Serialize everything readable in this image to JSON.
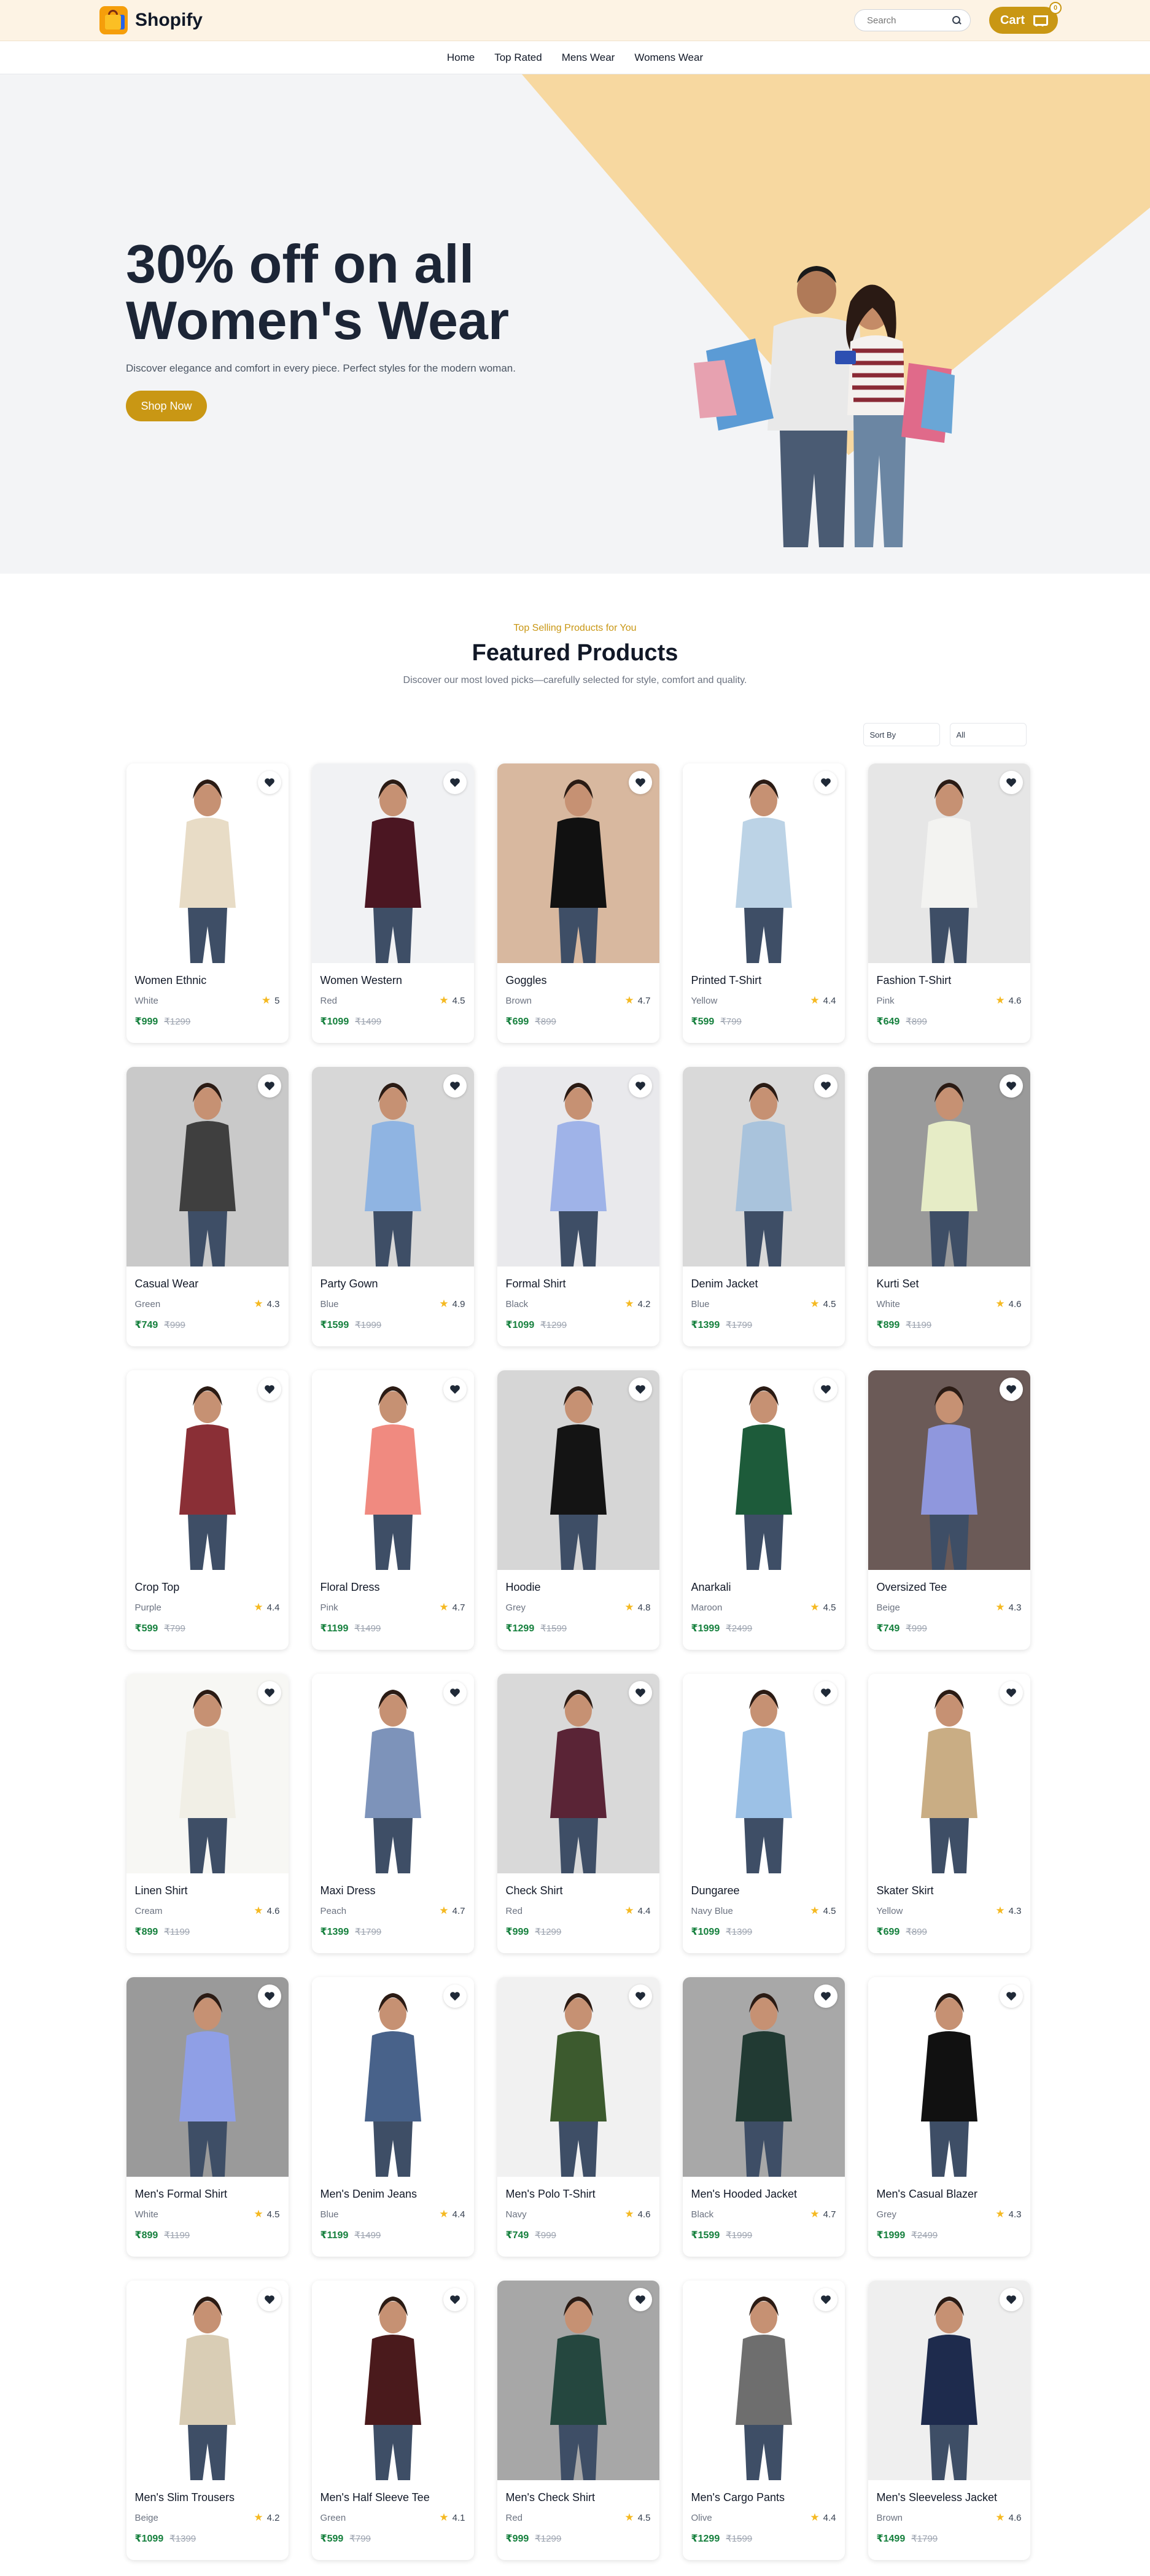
{
  "header": {
    "brand": "Shopify",
    "search_placeholder": "Search",
    "cart_label": "Cart",
    "cart_count": "0"
  },
  "nav": [
    "Home",
    "Top Rated",
    "Mens Wear",
    "Womens Wear"
  ],
  "hero": {
    "title_line1": "30% off on all",
    "title_line2": "Women's Wear",
    "subtitle": "Discover elegance and comfort in every piece. Perfect styles for the modern woman.",
    "cta": "Shop Now",
    "accent_color": "#f7d8a0"
  },
  "featured": {
    "kicker": "Top Selling Products for You",
    "title": "Featured Products",
    "description": "Discover our most loved picks—carefully selected for style, comfort and quality.",
    "sort_label": "Sort By",
    "filter_value": "All"
  },
  "products": [
    {
      "name": "Women Ethnic",
      "color": "White",
      "rating": "5",
      "price": "₹999",
      "old_price": "₹1299",
      "swatch": "#e8dcc6",
      "bg": "#ffffff"
    },
    {
      "name": "Women Western",
      "color": "Red",
      "rating": "4.5",
      "price": "₹1099",
      "old_price": "₹1499",
      "swatch": "#4b1622",
      "bg": "#f1f2f4"
    },
    {
      "name": "Goggles",
      "color": "Brown",
      "rating": "4.7",
      "price": "₹699",
      "old_price": "₹899",
      "swatch": "#111111",
      "bg": "#d8b89f"
    },
    {
      "name": "Printed T-Shirt",
      "color": "Yellow",
      "rating": "4.4",
      "price": "₹599",
      "old_price": "₹799",
      "swatch": "#bcd3e6",
      "bg": "#ffffff"
    },
    {
      "name": "Fashion T-Shirt",
      "color": "Pink",
      "rating": "4.6",
      "price": "₹649",
      "old_price": "₹899",
      "swatch": "#f3f3f1",
      "bg": "#e6e6e6"
    },
    {
      "name": "Casual Wear",
      "color": "Green",
      "rating": "4.3",
      "price": "₹749",
      "old_price": "₹999",
      "swatch": "#3f3f3f",
      "bg": "#c9c9c9"
    },
    {
      "name": "Party Gown",
      "color": "Blue",
      "rating": "4.9",
      "price": "₹1599",
      "old_price": "₹1999",
      "swatch": "#8fb4e2",
      "bg": "#d7d7d7"
    },
    {
      "name": "Formal Shirt",
      "color": "Black",
      "rating": "4.2",
      "price": "₹1099",
      "old_price": "₹1299",
      "swatch": "#9fb3e8",
      "bg": "#e9e9ec"
    },
    {
      "name": "Denim Jacket",
      "color": "Blue",
      "rating": "4.5",
      "price": "₹1399",
      "old_price": "₹1799",
      "swatch": "#a9c3dc",
      "bg": "#d9d9d9"
    },
    {
      "name": "Kurti Set",
      "color": "White",
      "rating": "4.6",
      "price": "₹899",
      "old_price": "₹1199",
      "swatch": "#e6ecc6",
      "bg": "#9a9a9a"
    },
    {
      "name": "Crop Top",
      "color": "Purple",
      "rating": "4.4",
      "price": "₹599",
      "old_price": "₹799",
      "swatch": "#8a2f36",
      "bg": "#ffffff"
    },
    {
      "name": "Floral Dress",
      "color": "Pink",
      "rating": "4.7",
      "price": "₹1199",
      "old_price": "₹1499",
      "swatch": "#f08a80",
      "bg": "#ffffff"
    },
    {
      "name": "Hoodie",
      "color": "Grey",
      "rating": "4.8",
      "price": "₹1299",
      "old_price": "₹1599",
      "swatch": "#141414",
      "bg": "#d6d6d6"
    },
    {
      "name": "Anarkali",
      "color": "Maroon",
      "rating": "4.5",
      "price": "₹1999",
      "old_price": "₹2499",
      "swatch": "#1d5b3a",
      "bg": "#ffffff"
    },
    {
      "name": "Oversized Tee",
      "color": "Beige",
      "rating": "4.3",
      "price": "₹749",
      "old_price": "₹999",
      "swatch": "#8f97dd",
      "bg": "#6b5a57"
    },
    {
      "name": "Linen Shirt",
      "color": "Cream",
      "rating": "4.6",
      "price": "₹899",
      "old_price": "₹1199",
      "swatch": "#f1efe6",
      "bg": "#f7f7f4"
    },
    {
      "name": "Maxi Dress",
      "color": "Peach",
      "rating": "4.7",
      "price": "₹1399",
      "old_price": "₹1799",
      "swatch": "#7d93ba",
      "bg": "#ffffff"
    },
    {
      "name": "Check Shirt",
      "color": "Red",
      "rating": "4.4",
      "price": "₹999",
      "old_price": "₹1299",
      "swatch": "#5a2436",
      "bg": "#d9d9d9"
    },
    {
      "name": "Dungaree",
      "color": "Navy Blue",
      "rating": "4.5",
      "price": "₹1099",
      "old_price": "₹1399",
      "swatch": "#9cc1e6",
      "bg": "#ffffff"
    },
    {
      "name": "Skater Skirt",
      "color": "Yellow",
      "rating": "4.3",
      "price": "₹699",
      "old_price": "₹899",
      "swatch": "#c9ad84",
      "bg": "#ffffff"
    },
    {
      "name": "Men's Formal Shirt",
      "color": "White",
      "rating": "4.5",
      "price": "₹899",
      "old_price": "₹1199",
      "swatch": "#8f9fe6",
      "bg": "#9a9a9a"
    },
    {
      "name": "Men's Denim Jeans",
      "color": "Blue",
      "rating": "4.4",
      "price": "₹1199",
      "old_price": "₹1499",
      "swatch": "#48628a",
      "bg": "#ffffff"
    },
    {
      "name": "Men's Polo T-Shirt",
      "color": "Navy",
      "rating": "4.6",
      "price": "₹749",
      "old_price": "₹999",
      "swatch": "#3c5a2e",
      "bg": "#f1f1f1"
    },
    {
      "name": "Men's Hooded Jacket",
      "color": "Black",
      "rating": "4.7",
      "price": "₹1599",
      "old_price": "₹1999",
      "swatch": "#213a33",
      "bg": "#a8a8a8"
    },
    {
      "name": "Men's Casual Blazer",
      "color": "Grey",
      "rating": "4.3",
      "price": "₹1999",
      "old_price": "₹2499",
      "swatch": "#111111",
      "bg": "#ffffff"
    },
    {
      "name": "Men's Slim Trousers",
      "color": "Beige",
      "rating": "4.2",
      "price": "₹1099",
      "old_price": "₹1399",
      "swatch": "#d9cdb5",
      "bg": "#ffffff"
    },
    {
      "name": "Men's Half Sleeve Tee",
      "color": "Green",
      "rating": "4.1",
      "price": "₹599",
      "old_price": "₹799",
      "swatch": "#4a1a1c",
      "bg": "#ffffff"
    },
    {
      "name": "Men's Check Shirt",
      "color": "Red",
      "rating": "4.5",
      "price": "₹999",
      "old_price": "₹1299",
      "swatch": "#25473f",
      "bg": "#a7a7a7"
    },
    {
      "name": "Men's Cargo Pants",
      "color": "Olive",
      "rating": "4.4",
      "price": "₹1299",
      "old_price": "₹1599",
      "swatch": "#6e6e6e",
      "bg": "#ffffff"
    },
    {
      "name": "Men's Sleeveless Jacket",
      "color": "Brown",
      "rating": "4.6",
      "price": "₹1499",
      "old_price": "₹1799",
      "swatch": "#1e2b4d",
      "bg": "#efefef"
    }
  ],
  "colors": {
    "brand_gold": "#c99714",
    "header_bg": "#fdf3e4",
    "price_green": "#15803d",
    "star": "#f5b921"
  }
}
